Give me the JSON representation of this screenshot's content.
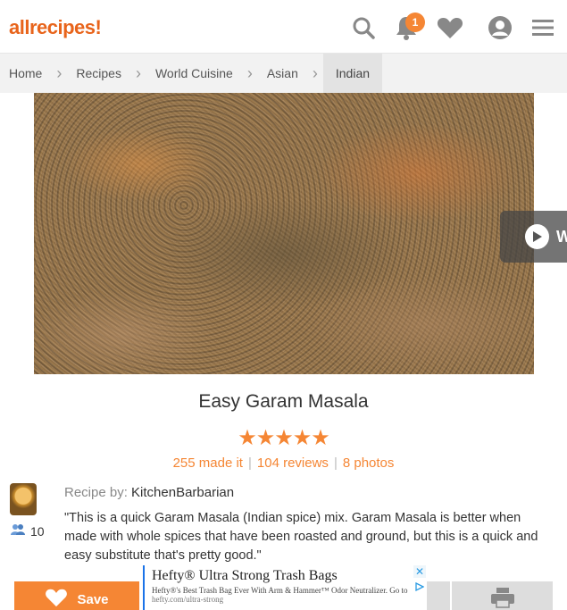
{
  "header": {
    "logo": "allrecipes",
    "notification_count": "1",
    "icons": [
      "search-icon",
      "bell-icon",
      "heart-icon",
      "user-icon",
      "menu-icon"
    ]
  },
  "breadcrumb": {
    "items": [
      "Home",
      "Recipes",
      "World Cuisine",
      "Asian",
      "Indian"
    ]
  },
  "video": {
    "label": "W"
  },
  "recipe": {
    "title": "Easy Garam Masala",
    "stars": "★★★★★",
    "rating": 5,
    "made_it": "255 made it",
    "reviews": "104 reviews",
    "photos": "8 photos",
    "recipe_by_label": "Recipe by:",
    "author": "KitchenBarbarian",
    "followers": "10",
    "description": "\"This is a quick Garam Masala (Indian spice) mix. Garam Masala is better when made with whole spices that have been roasted and ground, but this is a quick and easy substitute that's pretty good.\""
  },
  "actions": {
    "save_label": "Save"
  },
  "ad": {
    "title": "Hefty® Ultra Strong Trash Bags",
    "subtitle": "Hefty®'s Best Trash Bag Ever With Arm & Hammer™ Odor Neutralizer. Go to",
    "url": "hefty.com/ultra-strong",
    "close": "✕"
  },
  "colors": {
    "accent": "#f58634",
    "breadcrumb_bg": "#f2f2f2",
    "icon_grey": "#888888"
  }
}
